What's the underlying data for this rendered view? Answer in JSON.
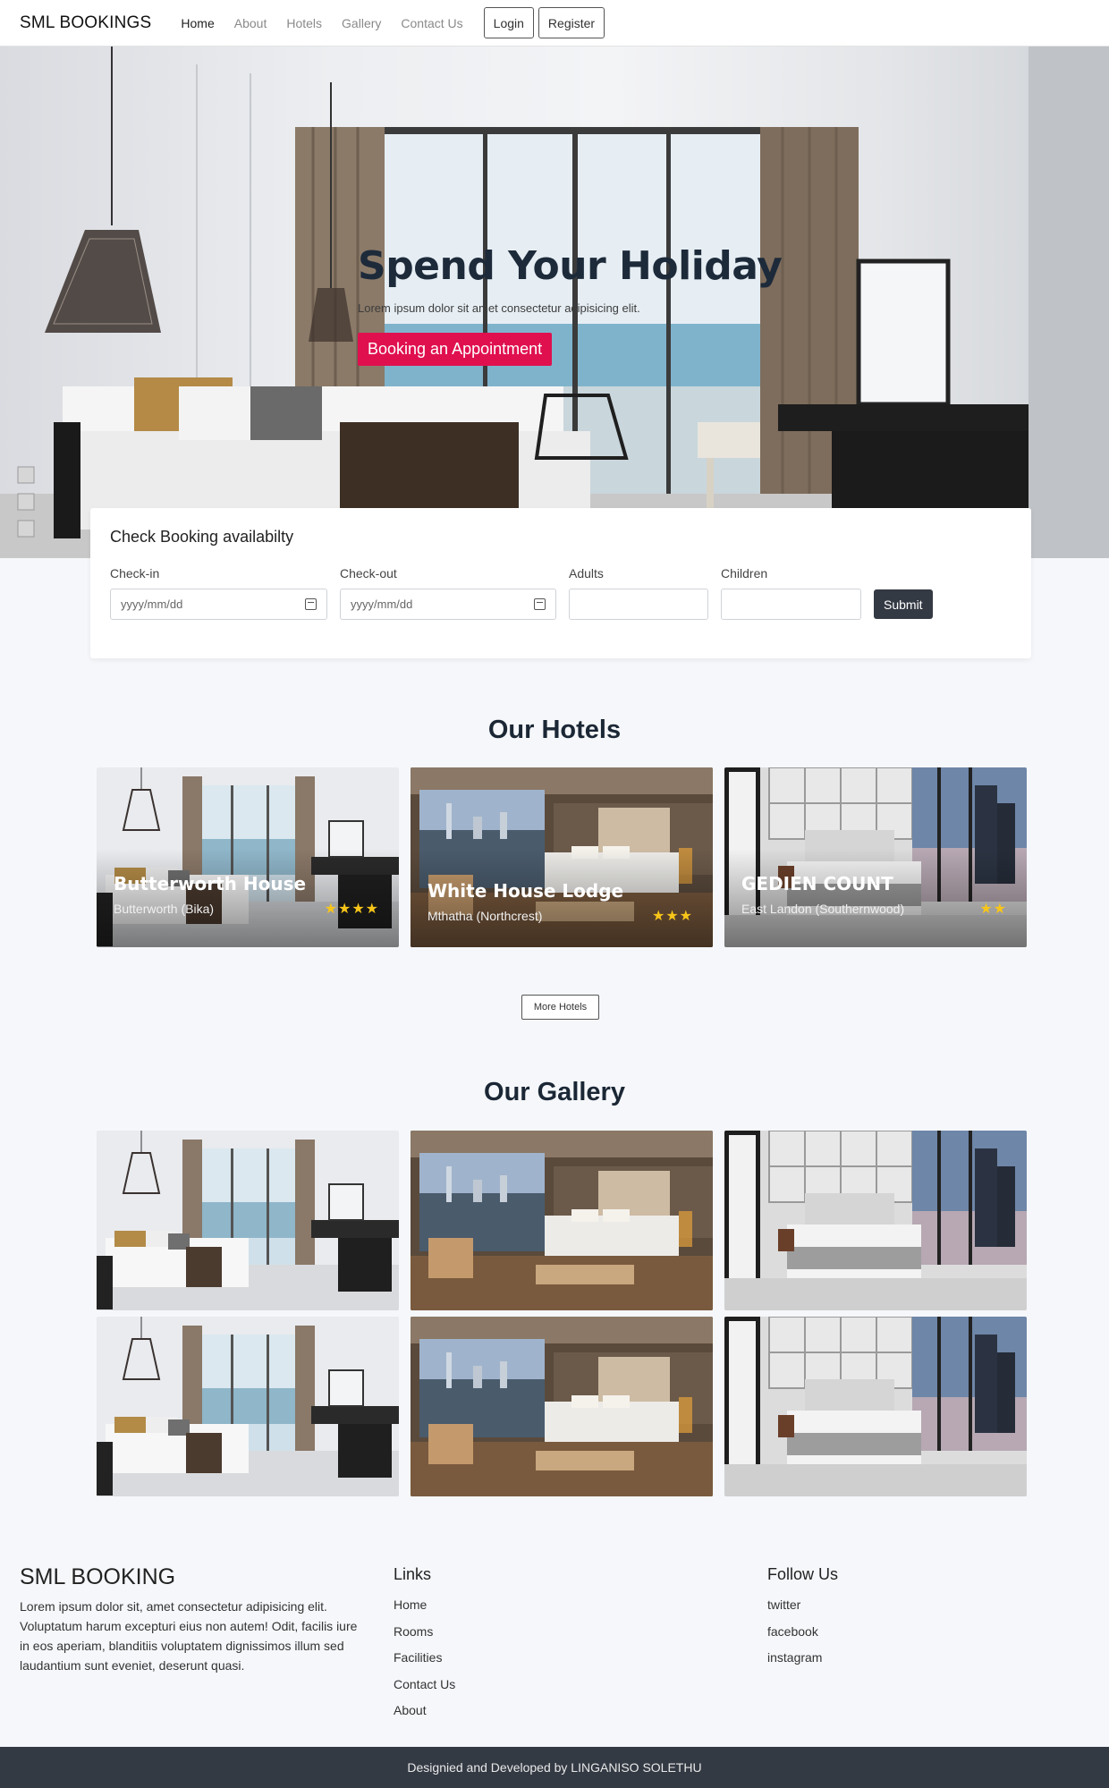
{
  "nav": {
    "brand": "SML BOOKINGS",
    "links": [
      "Home",
      "About",
      "Hotels",
      "Gallery",
      "Contact Us"
    ],
    "login": "Login",
    "register": "Register"
  },
  "hero": {
    "title": "Spend Your Holiday",
    "subtitle": "Lorem ipsum dolor sit amet consectetur adipisicing elit.",
    "cta": "Booking an Appointment"
  },
  "booking": {
    "title": "Check Booking availabilty",
    "checkin_label": "Check-in",
    "checkin_placeholder": "yyyy/mm/dd",
    "checkout_label": "Check-out",
    "checkout_placeholder": "yyyy/mm/dd",
    "adults_label": "Adults",
    "children_label": "Children",
    "submit": "Submit"
  },
  "hotels": {
    "title": "Our Hotels",
    "items": [
      {
        "name": "Butterworth House",
        "location": "Butterworth (Bika)",
        "stars": "★★★★",
        "rating": 4
      },
      {
        "name": "White House Lodge",
        "location": "Mthatha (Northcrest)",
        "stars": "★★★",
        "rating": 3
      },
      {
        "name": "GEDIEN COUNT",
        "location": "East Landon (Southernwood)",
        "stars": "★★",
        "rating": 2
      }
    ],
    "more": "More Hotels"
  },
  "gallery": {
    "title": "Our Gallery"
  },
  "footer": {
    "brand": "SML BOOKING",
    "description": "Lorem ipsum dolor sit, amet consectetur adipisicing elit. Voluptatum harum excepturi eius non autem! Odit, facilis iure in eos aperiam, blanditiis voluptatem dignissimos illum sed laudantium sunt eveniet, deserunt quasi.",
    "links_title": "Links",
    "links": [
      "Home",
      "Rooms",
      "Facilities",
      "Contact Us",
      "About"
    ],
    "follow_title": "Follow Us",
    "social": [
      "twitter",
      "facebook",
      "instagram"
    ],
    "copyright": "Designied and Developed by LINGANISO SOLETHU"
  },
  "colors": {
    "accent": "#e0104f",
    "dark": "#343a44",
    "star": "#f7c51a",
    "title": "#1d2a3a"
  }
}
